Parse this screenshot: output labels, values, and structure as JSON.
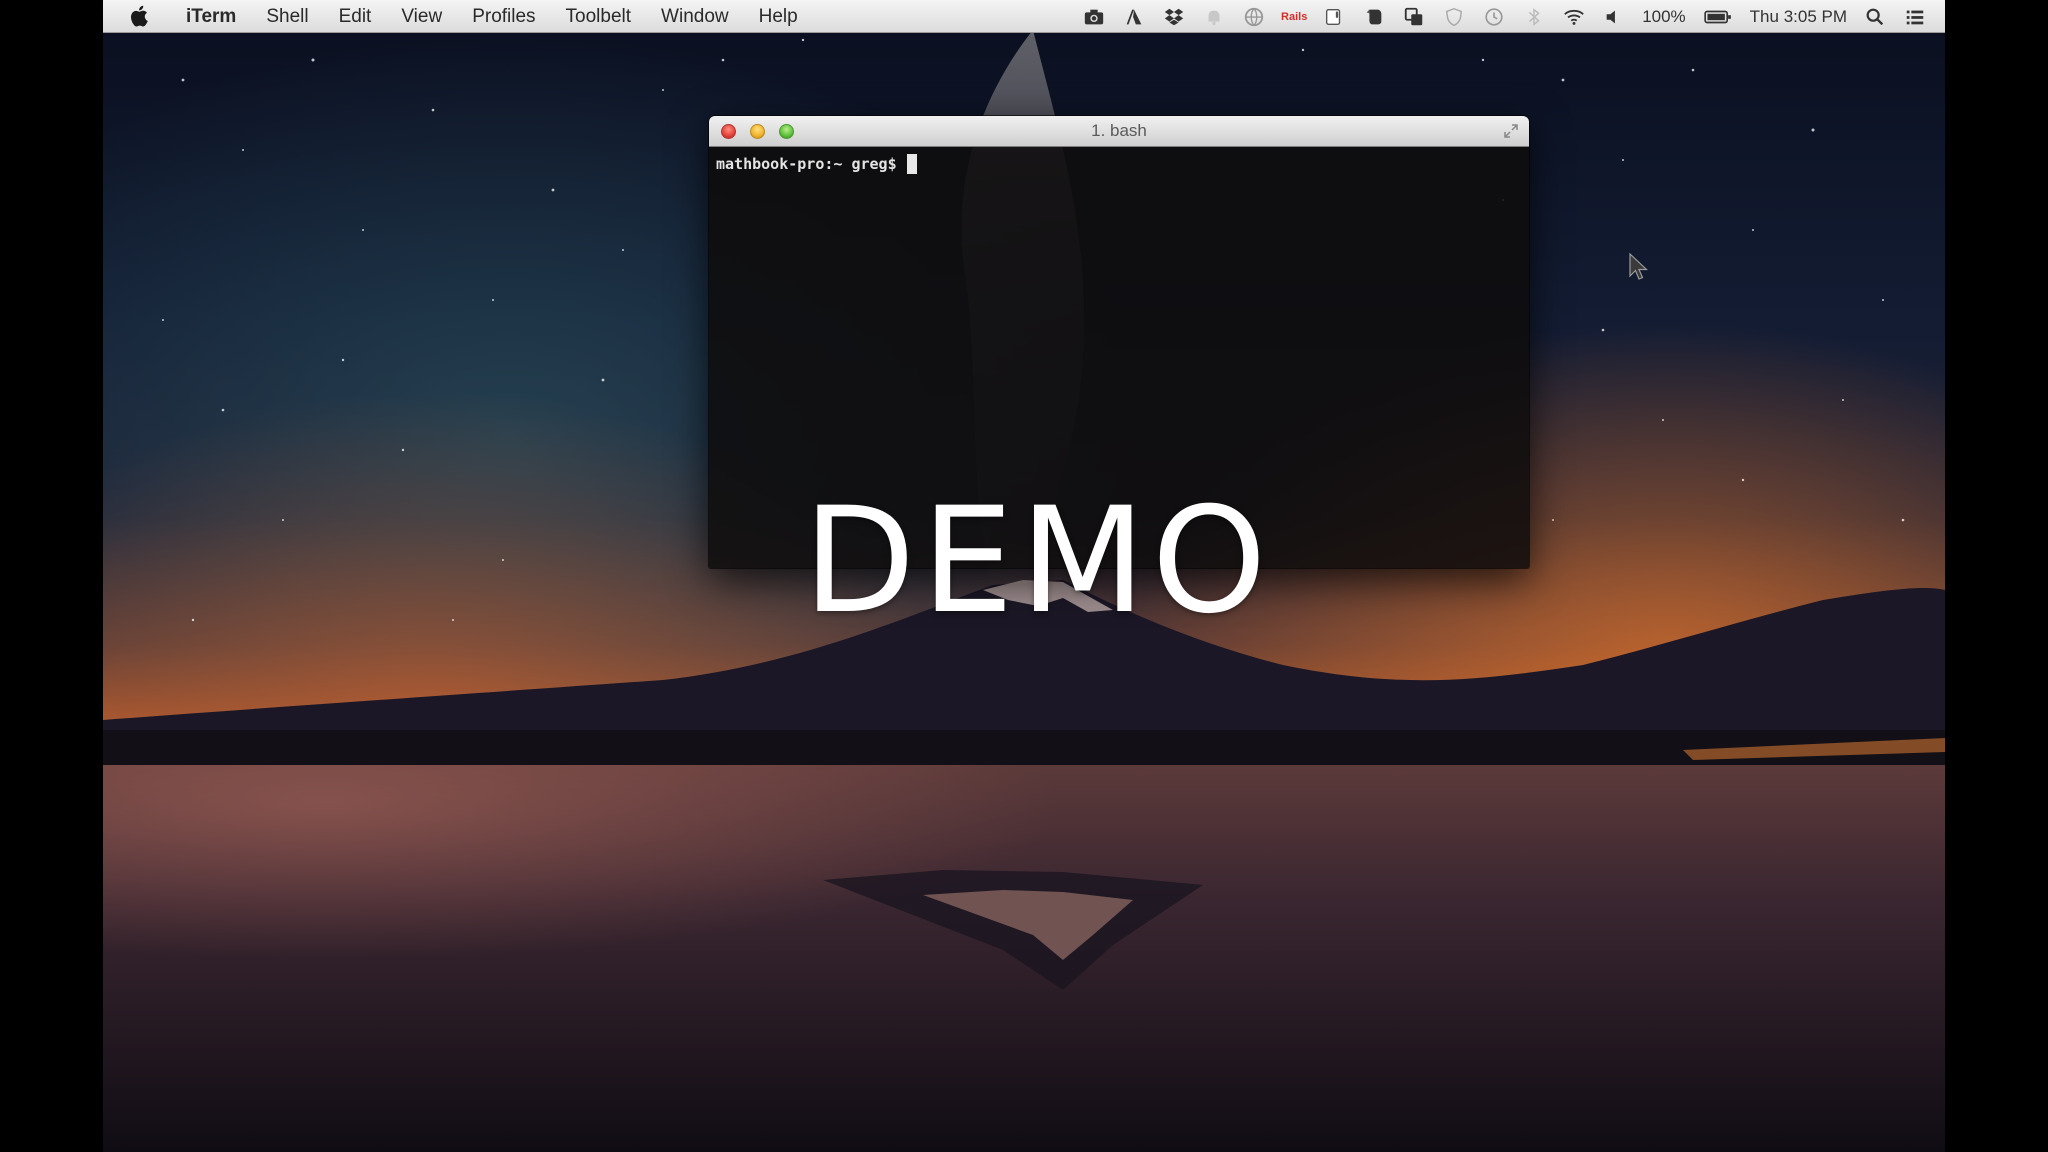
{
  "menubar": {
    "app_name": "iTerm",
    "items": [
      "Shell",
      "Edit",
      "View",
      "Profiles",
      "Toolbelt",
      "Window",
      "Help"
    ],
    "status": {
      "rails_label": "Rails",
      "battery": "100%",
      "clock": "Thu 3:05 PM",
      "icons": [
        "camera-icon",
        "adobe-icon",
        "dropbox-icon",
        "bell-icon",
        "globe-icon",
        "rails-icon",
        "scrollbar-icon",
        "evernote-icon",
        "copy-icon",
        "shield-icon",
        "time-machine-icon",
        "bluetooth-icon",
        "wifi-icon",
        "volume-icon",
        "battery-icon",
        "search-icon",
        "list-icon"
      ]
    }
  },
  "terminal": {
    "title": "1. bash",
    "prompt": "mathbook-pro:~ greg$"
  },
  "overlay": {
    "label": "DEMO"
  },
  "colors": {
    "menubar": "#e6e6e6",
    "terminal_bg": "#0e0c0c",
    "sky_top": "#0b1222",
    "horizon_glow": "#e0762a"
  }
}
